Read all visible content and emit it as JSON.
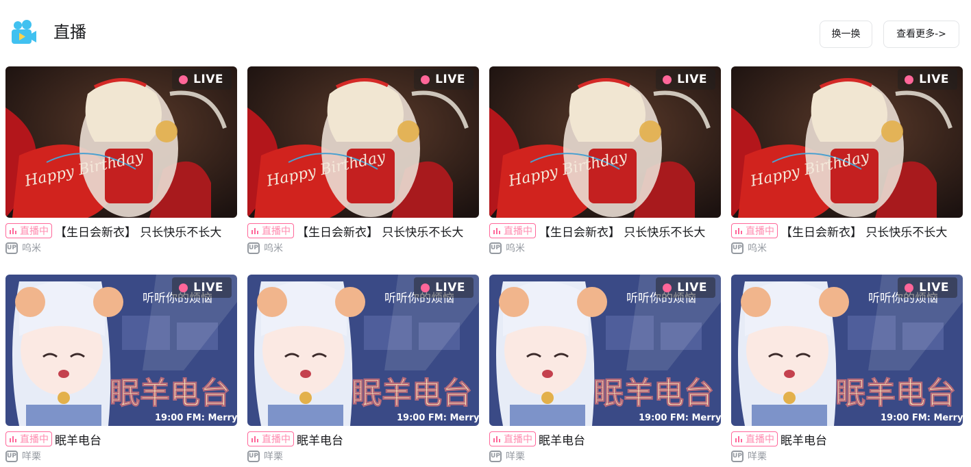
{
  "section": {
    "title": "直播",
    "icon": "camera-video-icon",
    "refresh_label": "换一换",
    "more_label": "查看更多->"
  },
  "colors": {
    "accent_pink": "#ff6699",
    "muted": "#9499a0",
    "icon_blue": "#41c1f0"
  },
  "live_tag": "LIVE",
  "status_badge": "直播中",
  "up_label": "UP",
  "rows": [
    {
      "cards": [
        {
          "title": "【生日会新衣】 只长快乐不长大",
          "uploader": "呜米",
          "cover_text": "Happy Birthday"
        },
        {
          "title": "【生日会新衣】 只长快乐不长大",
          "uploader": "呜米",
          "cover_text": "Happy Birthday"
        },
        {
          "title": "【生日会新衣】 只长快乐不长大",
          "uploader": "呜米",
          "cover_text": "Happy Birthday"
        },
        {
          "title": "【生日会新衣】 只长快乐不长大",
          "uploader": "呜米",
          "cover_text": "Happy Birthday"
        }
      ]
    },
    {
      "cards": [
        {
          "title": "眠羊电台",
          "uploader": "咩栗",
          "cover_text": "眠羊电台",
          "cover_sub": "听听你的烦恼",
          "cover_time": "19:00  FM: Merry"
        },
        {
          "title": "眠羊电台",
          "uploader": "咩栗",
          "cover_text": "眠羊电台",
          "cover_sub": "听听你的烦恼",
          "cover_time": "19:00  FM: Merry"
        },
        {
          "title": "眠羊电台",
          "uploader": "咩栗",
          "cover_text": "眠羊电台",
          "cover_sub": "听听你的烦恼",
          "cover_time": "19:00  FM: Merry"
        },
        {
          "title": "眠羊电台",
          "uploader": "咩栗",
          "cover_text": "眠羊电台",
          "cover_sub": "听听你的烦恼",
          "cover_time": "19:00  FM: Merry"
        }
      ]
    }
  ]
}
